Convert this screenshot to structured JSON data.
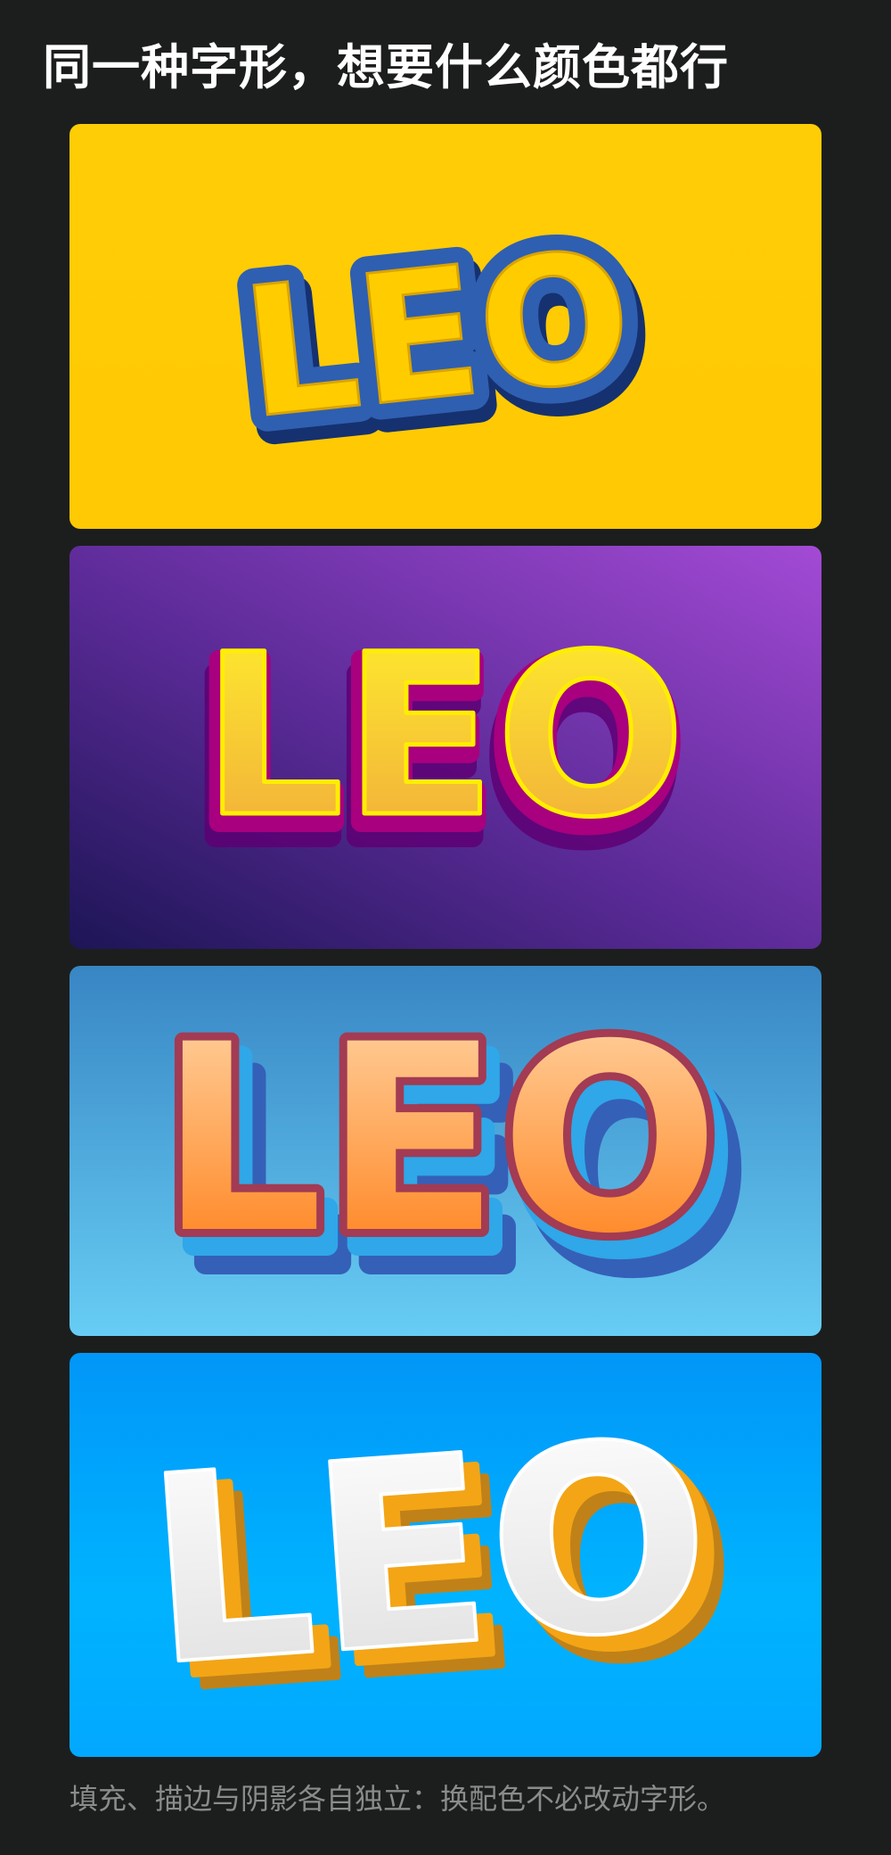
{
  "page": {
    "title": "同一种字形，想要什么颜色都行",
    "caption": "填充、描边与阴影各自独立：换配色不必改动字形。"
  },
  "cards": [
    {
      "word": "LEO",
      "background": [
        "#ffcd05",
        "#ffc904"
      ],
      "fill": "#ffcc00",
      "stroke": "#2f5fb1",
      "extrude": "#1b3f8a"
    },
    {
      "word": "LEO",
      "background": [
        "#a34ad5",
        "#1d1556"
      ],
      "fill": [
        "#fff02c",
        "#f0a83c"
      ],
      "stroke": "#ffee00",
      "extrude": "#a8007e"
    },
    {
      "word": "LEO",
      "background": [
        "#3886c4",
        "#67cdf4"
      ],
      "fill": [
        "#ffd7a8",
        "#ff7a10"
      ],
      "stroke": "#a23b53",
      "extrude": "#2fa7e8"
    },
    {
      "word": "LEO",
      "background": [
        "#0196f8",
        "#02a8ff"
      ],
      "fill": [
        "#ffffff",
        "#dedede"
      ],
      "stroke": "#ffffff",
      "extrude": "#f3a516"
    }
  ]
}
